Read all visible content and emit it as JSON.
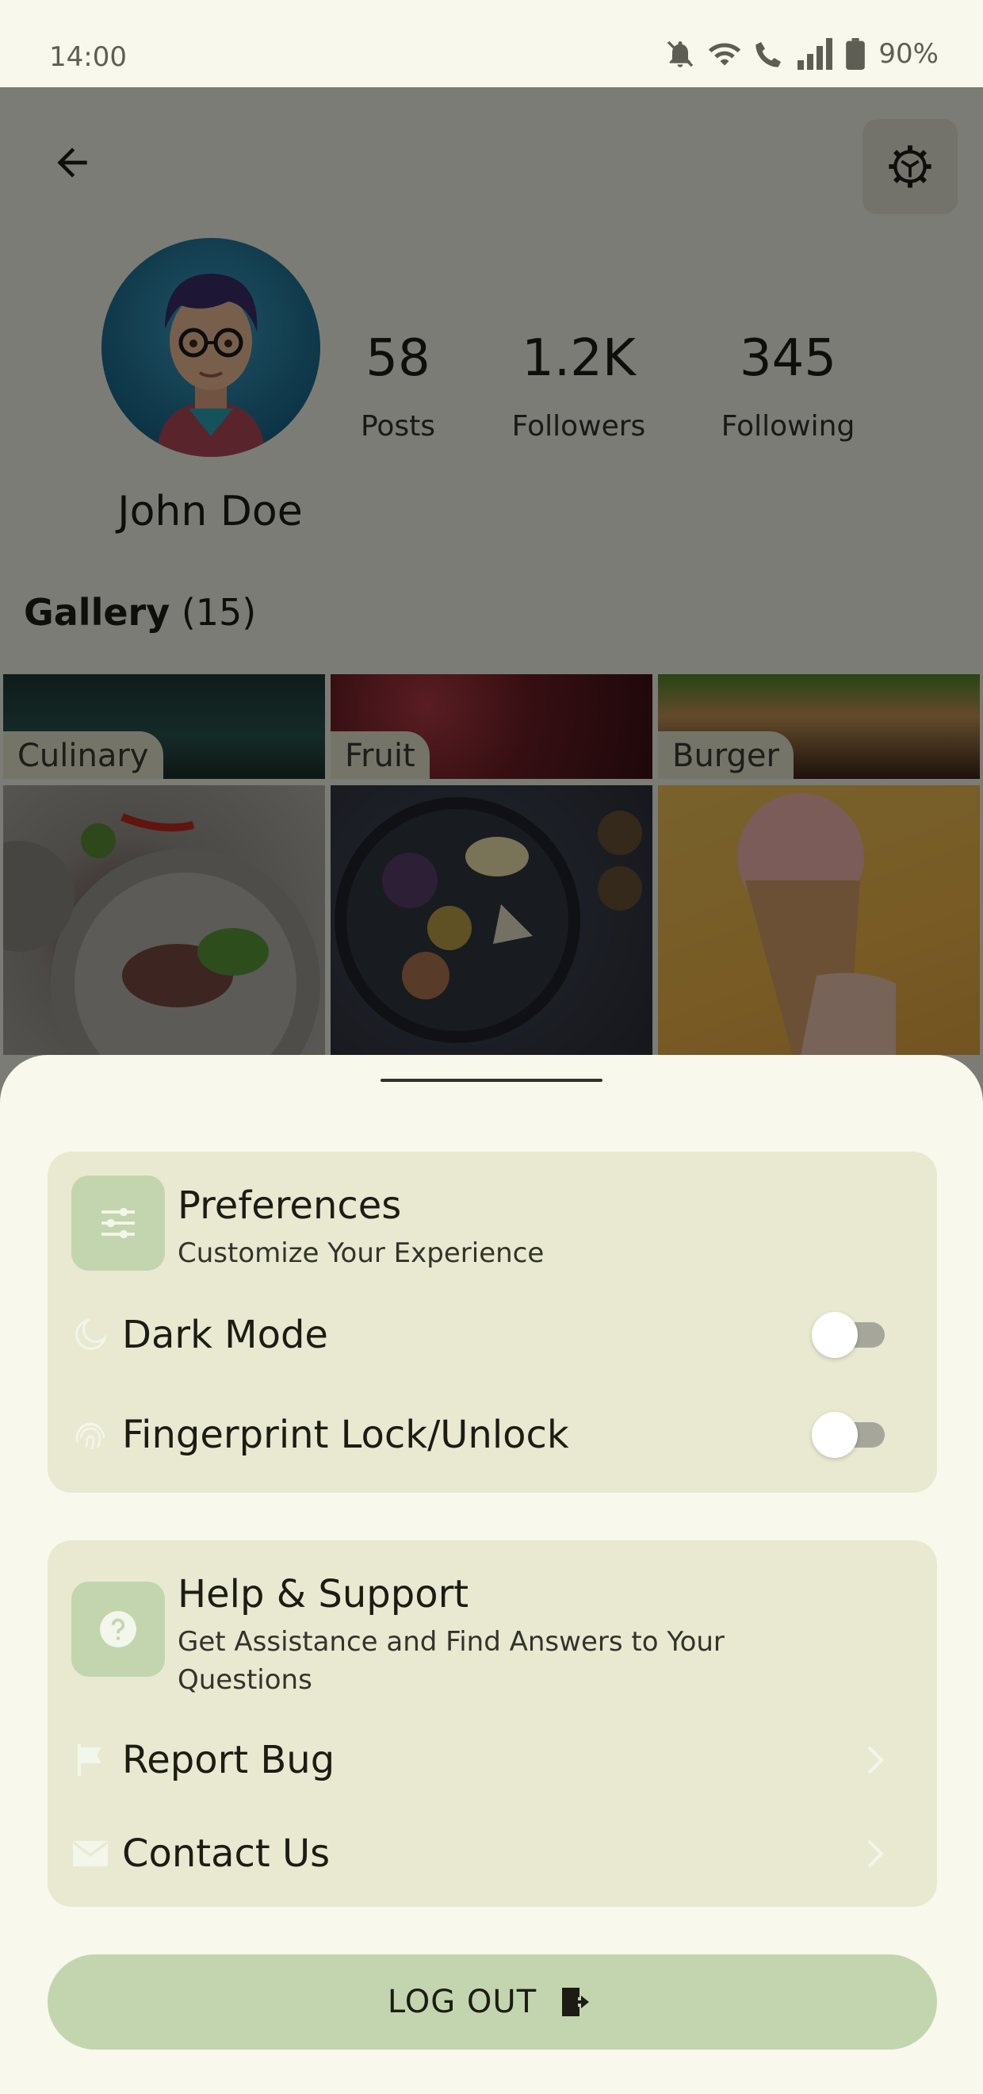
{
  "status_bar": {
    "time": "14:00",
    "battery": "90%"
  },
  "profile": {
    "name": "John Doe",
    "stats": [
      {
        "value": "58",
        "label": "Posts"
      },
      {
        "value": "1.2K",
        "label": "Followers"
      },
      {
        "value": "345",
        "label": "Following"
      }
    ]
  },
  "gallery": {
    "title": "Gallery",
    "count": "(15)",
    "tiles": [
      {
        "label": "Culinary"
      },
      {
        "label": "Fruit"
      },
      {
        "label": "Burger"
      }
    ]
  },
  "sheet": {
    "preferences": {
      "title": "Preferences",
      "subtitle": "Customize Your Experience",
      "items": [
        {
          "label": "Dark Mode",
          "icon": "moon-icon",
          "enabled": false
        },
        {
          "label": "Fingerprint Lock/Unlock",
          "icon": "fingerprint-icon",
          "enabled": false
        }
      ]
    },
    "help": {
      "title": "Help & Support",
      "subtitle": "Get Assistance and Find Answers to Your Questions",
      "items": [
        {
          "label": "Report Bug",
          "icon": "flag-icon"
        },
        {
          "label": "Contact Us",
          "icon": "mail-icon"
        }
      ]
    },
    "logout_label": "LOG OUT"
  },
  "colors": {
    "background": "#f8f8ec",
    "card": "#e9e9d2",
    "accent": "#c3d5ae",
    "scrim": "rgba(0,0,0,0.5)"
  }
}
